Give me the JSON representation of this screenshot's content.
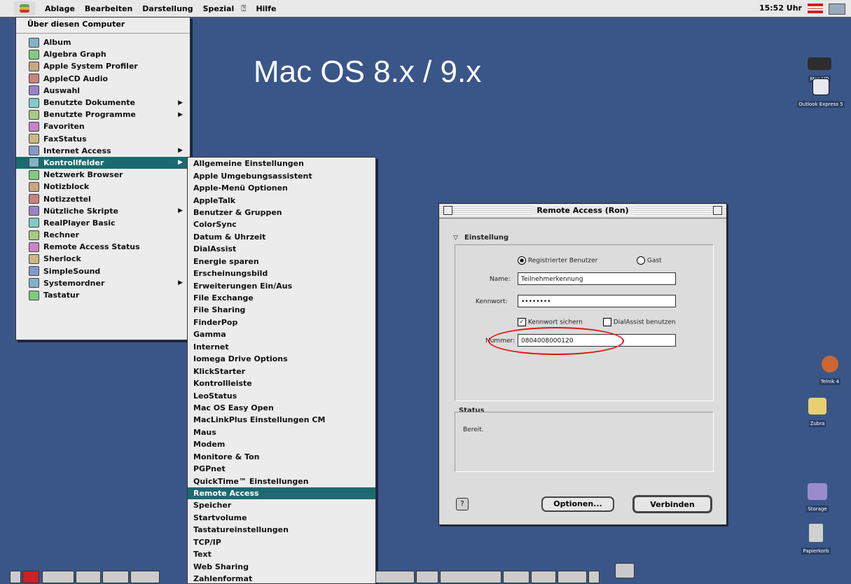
{
  "menubar": {
    "items": [
      "Ablage",
      "Bearbeiten",
      "Darstellung",
      "Spezial",
      "Hilfe"
    ],
    "clock": "15:52 Uhr"
  },
  "headline": "Mac OS 8.x / 9.x",
  "apple_menu": {
    "header": "Über diesen Computer",
    "items": [
      {
        "label": "Album",
        "submenu": false
      },
      {
        "label": "Algebra Graph",
        "submenu": false
      },
      {
        "label": "Apple System Profiler",
        "submenu": false
      },
      {
        "label": "AppleCD Audio",
        "submenu": false
      },
      {
        "label": "Auswahl",
        "submenu": false
      },
      {
        "label": "Benutzte Dokumente",
        "submenu": true
      },
      {
        "label": "Benutzte Programme",
        "submenu": true
      },
      {
        "label": "Favoriten",
        "submenu": false
      },
      {
        "label": "FaxStatus",
        "submenu": false
      },
      {
        "label": "Internet Access",
        "submenu": true
      },
      {
        "label": "Kontrollfelder",
        "submenu": true,
        "selected": true
      },
      {
        "label": "Netzwerk Browser",
        "submenu": false
      },
      {
        "label": "Notizblock",
        "submenu": false
      },
      {
        "label": "Notizzettel",
        "submenu": false
      },
      {
        "label": "Nützliche Skripte",
        "submenu": true
      },
      {
        "label": "RealPlayer Basic",
        "submenu": false
      },
      {
        "label": "Rechner",
        "submenu": false
      },
      {
        "label": "Remote Access Status",
        "submenu": false
      },
      {
        "label": "Sherlock",
        "submenu": false
      },
      {
        "label": "SimpleSound",
        "submenu": false
      },
      {
        "label": "Systemordner",
        "submenu": true
      },
      {
        "label": "Tastatur",
        "submenu": false
      }
    ]
  },
  "control_panels": {
    "items": [
      "Allgemeine Einstellungen",
      "Apple Umgebungsassistent",
      "Apple-Menü Optionen",
      "AppleTalk",
      "Benutzer & Gruppen",
      "ColorSync",
      "Datum & Uhrzeit",
      "DialAssist",
      "Energie sparen",
      "Erscheinungsbild",
      "Erweiterungen Ein/Aus",
      "File Exchange",
      "File Sharing",
      "FinderPop",
      "Gamma",
      "Internet",
      "Iomega Drive Options",
      "KlickStarter",
      "Kontrollleiste",
      "LeoStatus",
      "Mac OS Easy Open",
      "MacLinkPlus Einstellungen CM",
      "Maus",
      "Modem",
      "Monitore & Ton",
      "PGPnet",
      "QuickTime™ Einstellungen",
      "Remote Access",
      "Speicher",
      "Startvolume",
      "Tastatureinstellungen",
      "TCP/IP",
      "Text",
      "Web Sharing",
      "Zahlenformat"
    ],
    "selected": "Remote Access"
  },
  "dialog": {
    "title": "Remote Access (Ron)",
    "section_setup": "Einstellung",
    "radio_registered": "Registrierter Benutzer",
    "radio_guest": "Gast",
    "name_label": "Name:",
    "name_value": "Teilnehmerkennung",
    "password_label": "Kennwort:",
    "password_value": "••••••••",
    "save_password_label": "Kennwort sichern",
    "use_dialassist_label": "DialAssist benutzen",
    "number_label": "Nummer:",
    "number_value": "0804008000120",
    "section_status": "Status",
    "status_text": "Bereit.",
    "options_button": "Optionen...",
    "connect_button": "Verbinden"
  },
  "desktop_icons": {
    "mac_hd": "Mac HD",
    "outlook": "Outlook Express 5",
    "icon3": "Telnik 4",
    "icon4": "Zubra",
    "storage": "Storage",
    "trash": "Papierkorb"
  },
  "colors": {
    "desktop": "#3a5688",
    "selection": "#1c6a70",
    "highlight_circle": "#e01010"
  }
}
